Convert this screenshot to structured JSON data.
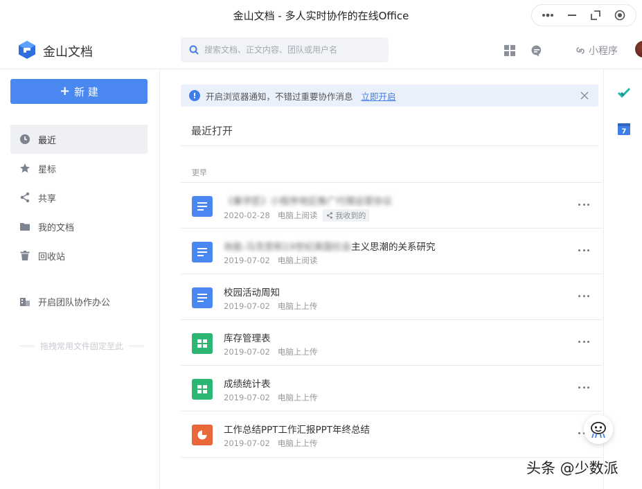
{
  "window": {
    "title": "金山文档 - 多人实时协作的在线Office"
  },
  "header": {
    "brand": "金山文档",
    "search_placeholder": "搜索文档、正文内容、团队或用户名",
    "mini_program": "小程序"
  },
  "sidebar": {
    "new_label": "新 建",
    "items": [
      {
        "label": "最近",
        "icon": "clock-icon",
        "active": true
      },
      {
        "label": "星标",
        "icon": "star-icon"
      },
      {
        "label": "共享",
        "icon": "share-icon"
      },
      {
        "label": "我的文档",
        "icon": "folder-icon"
      },
      {
        "label": "回收站",
        "icon": "trash-icon"
      },
      {
        "label": "开启团队协作办公",
        "icon": "building-icon"
      }
    ],
    "pin_hint": "拖拽常用文件固定至此"
  },
  "banner": {
    "text": "开启浏览器通知，不错过重要协作消息",
    "link": "立即开启"
  },
  "main": {
    "section_title": "最近打开",
    "group_label": "更早",
    "files": [
      {
        "name": "《秦学匠》小程序地区推广代理运营协议",
        "blurred": "",
        "date": "2020-02-28",
        "status": "电脑上阅读",
        "tag": "我收到的",
        "type": "doc"
      },
      {
        "name": "主义思潮的关系研究",
        "blurred": "尚能-马克思和19世纪英国社会",
        "date": "2019-07-02",
        "status": "电脑上阅读",
        "tag": "",
        "type": "doc"
      },
      {
        "name": "校园活动周知",
        "blurred": "",
        "date": "2019-07-02",
        "status": "电脑上上传",
        "tag": "",
        "type": "doc"
      },
      {
        "name": "库存管理表",
        "blurred": "",
        "date": "2019-07-02",
        "status": "电脑上上传",
        "tag": "",
        "type": "sheet"
      },
      {
        "name": "成绩统计表",
        "blurred": "",
        "date": "2019-07-02",
        "status": "电脑上上传",
        "tag": "",
        "type": "sheet"
      },
      {
        "name": "工作总结PPT工作汇报PPT年终总结",
        "blurred": "",
        "date": "2019-07-02",
        "status": "电脑上上传",
        "tag": "",
        "type": "ppt"
      }
    ]
  },
  "rail": {
    "calendar_day": "7"
  },
  "watermark": "头条 @少数派",
  "colors": {
    "accent": "#4a87f0",
    "doc": "#4a87f0",
    "sheet": "#2bb673",
    "ppt": "#e8683a"
  }
}
